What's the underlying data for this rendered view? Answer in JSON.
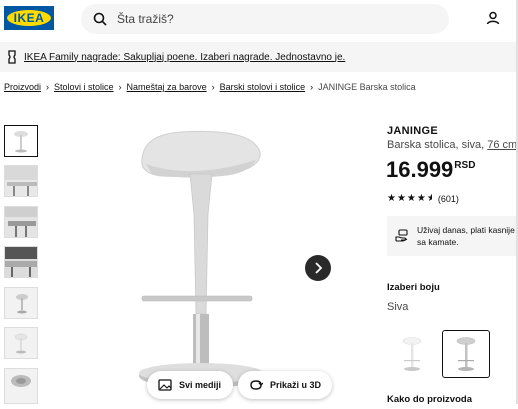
{
  "header": {
    "logo_text": "IKEA",
    "search_placeholder": "Šta tražiš?"
  },
  "banner": {
    "text": "IKEA Family nagrade: Sakupljaj poene. Izaberi nagrade. Jednostavno je."
  },
  "breadcrumb": {
    "items": [
      "Proizvodi",
      "Stolovi i stolice",
      "Nameštaj za barove",
      "Barski stolovi i stolice"
    ],
    "current": "JANINGE Barska stolica"
  },
  "gallery": {
    "thumbnail_count": 7,
    "selected_index": 0,
    "buttons": {
      "media": "Svi mediji",
      "view3d": "Prikaži u 3D"
    }
  },
  "product": {
    "name": "JANINGE",
    "description": "Barska stolica, siva,",
    "size_link": "76 cm",
    "price": "16.999",
    "currency": "RSD",
    "rating_value": 4.5,
    "rating_count": "(601)",
    "promo_text": "Uživaj danas, plati kasnije sa kamate."
  },
  "color_select": {
    "heading": "Izaberi boju",
    "selected": "Siva",
    "options": [
      "bela",
      "siva"
    ],
    "selected_index": 1
  },
  "delivery": {
    "heading": "Kako do proizvoda"
  },
  "colors": {
    "brand_blue": "#0058a3",
    "brand_yellow": "#ffdb00",
    "text": "#111111",
    "muted": "#484848"
  }
}
